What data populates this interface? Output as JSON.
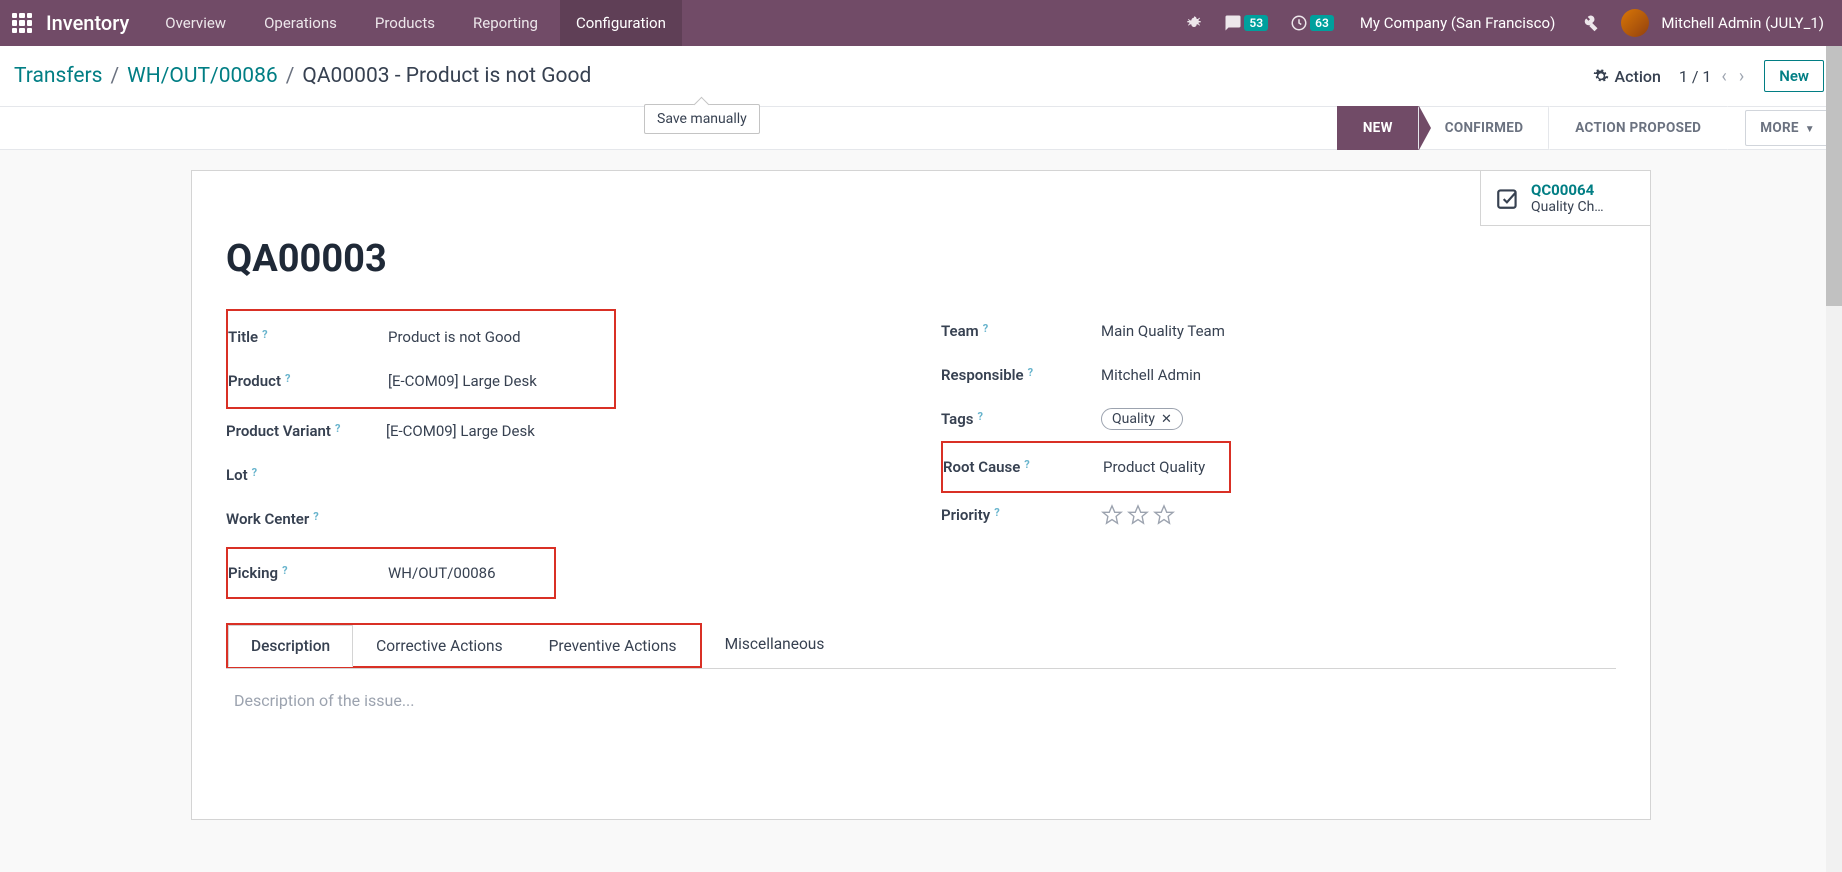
{
  "nav": {
    "brand": "Inventory",
    "items": [
      "Overview",
      "Operations",
      "Products",
      "Reporting",
      "Configuration"
    ],
    "active_index": 4,
    "msg_badge": "53",
    "clock_badge": "63",
    "company": "My Company (San Francisco)",
    "user": "Mitchell Admin (JULY_1)"
  },
  "breadcrumb": {
    "part1": "Transfers",
    "part2": "WH/OUT/00086",
    "part3": "QA00003 - Product is not Good",
    "tooltip": "Save manually",
    "action_label": "Action",
    "pager": "1 / 1",
    "new_label": "New"
  },
  "stages": {
    "s1": "NEW",
    "s2": "CONFIRMED",
    "s3": "ACTION PROPOSED",
    "s4": "MORE"
  },
  "statbox": {
    "title": "QC00064",
    "sub": "Quality Ch…"
  },
  "record": {
    "name": "QA00003",
    "left": {
      "title_lbl": "Title",
      "title_val": "Product is not Good",
      "product_lbl": "Product",
      "product_val": "[E-COM09] Large Desk",
      "variant_lbl": "Product Variant",
      "variant_val": "[E-COM09] Large Desk",
      "lot_lbl": "Lot",
      "lot_val": "",
      "wc_lbl": "Work Center",
      "wc_val": "",
      "picking_lbl": "Picking",
      "picking_val": "WH/OUT/00086"
    },
    "right": {
      "team_lbl": "Team",
      "team_val": "Main Quality Team",
      "resp_lbl": "Responsible",
      "resp_val": "Mitchell Admin",
      "tags_lbl": "Tags",
      "tags_val": "Quality",
      "root_lbl": "Root Cause",
      "root_val": "Product Quality",
      "prio_lbl": "Priority"
    }
  },
  "tabs": {
    "t1": "Description",
    "t2": "Corrective Actions",
    "t3": "Preventive Actions",
    "t4": "Miscellaneous",
    "placeholder": "Description of the issue..."
  }
}
